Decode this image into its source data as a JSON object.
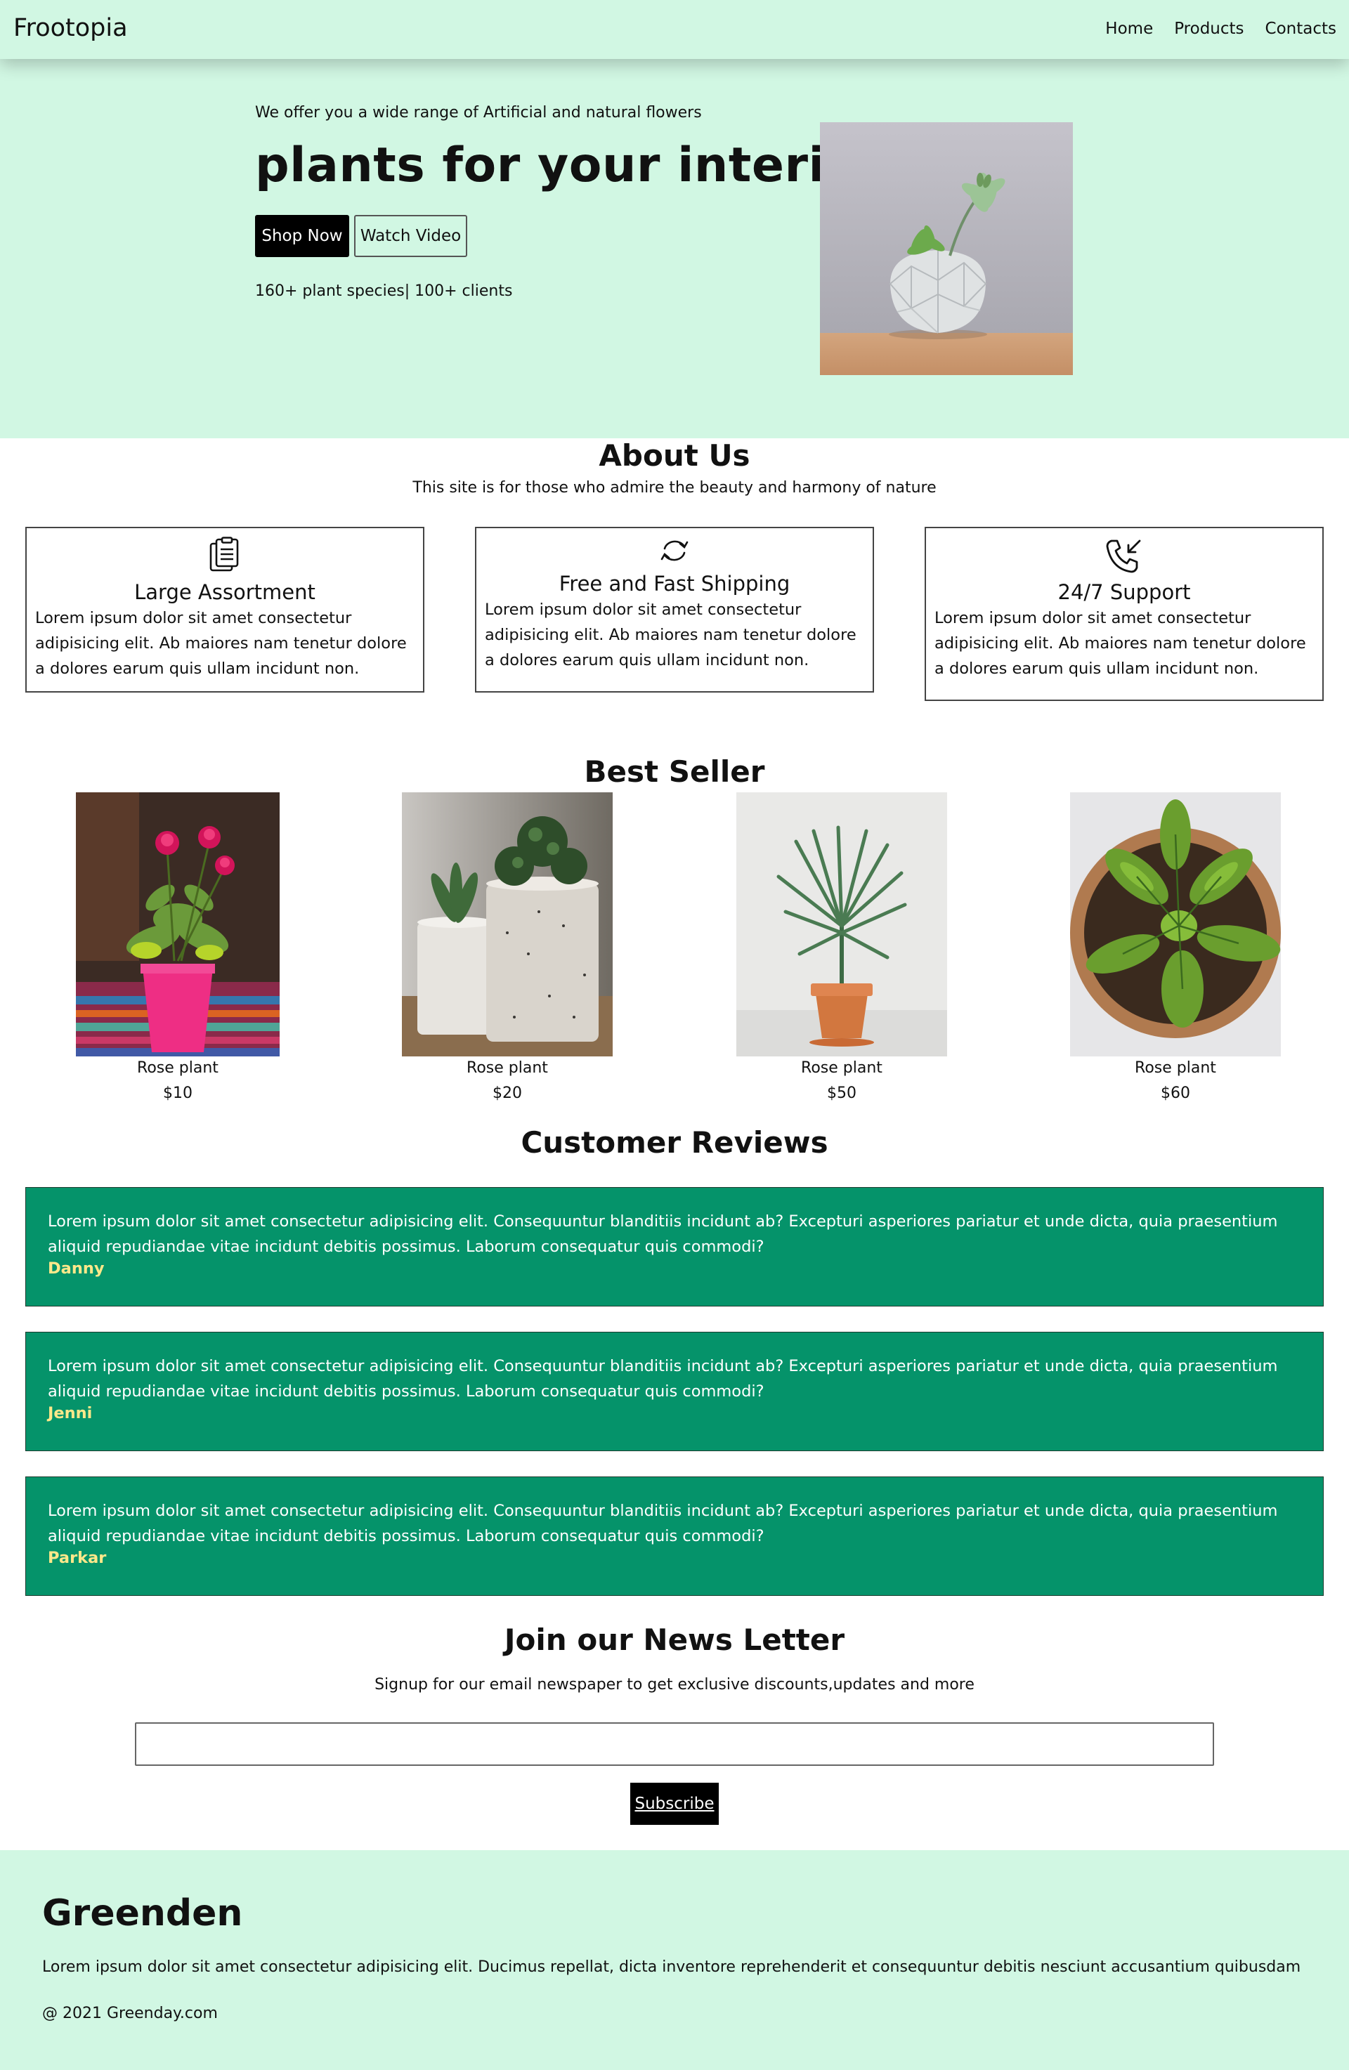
{
  "nav": {
    "brand": "Frootopia",
    "links": [
      "Home",
      "Products",
      "Contacts"
    ]
  },
  "hero": {
    "subtitle": "We offer you a wide range of Artificial and natural flowers",
    "title": "plants for your interior",
    "shop_label": "Shop Now",
    "watch_label": "Watch Video",
    "stats": "160+ plant species| 100+ clients"
  },
  "about": {
    "title": "About Us",
    "subtitle": "This site is for those who admire the beauty and harmony of nature",
    "cards": [
      {
        "icon": "clipboard-icon",
        "title": "Large Assortment",
        "text": "Lorem ipsum dolor sit amet consectetur adipisicing elit. Ab maiores nam tenetur dolore a dolores earum quis ullam incidunt non."
      },
      {
        "icon": "refresh-icon",
        "title": "Free and Fast Shipping",
        "text": "Lorem ipsum dolor sit amet consectetur adipisicing elit. Ab maiores nam tenetur dolore a dolores earum quis ullam incidunt non."
      },
      {
        "icon": "phone-incoming-icon",
        "title": "24/7 Support",
        "text": "Lorem ipsum dolor sit amet consectetur adipisicing elit. Ab maiores nam tenetur dolore a dolores earum quis ullam incidunt non."
      }
    ]
  },
  "best_seller": {
    "title": "Best Seller",
    "products": [
      {
        "name": "Rose plant",
        "price": "$10"
      },
      {
        "name": "Rose plant",
        "price": "$20"
      },
      {
        "name": "Rose plant",
        "price": "$50"
      },
      {
        "name": "Rose plant",
        "price": "$60"
      }
    ]
  },
  "reviews": {
    "title": "Customer Reviews",
    "items": [
      {
        "text": "Lorem ipsum dolor sit amet consectetur adipisicing elit. Consequuntur blanditiis incidunt ab? Excepturi asperiores pariatur et unde dicta, quia praesentium aliquid repudiandae vitae incidunt debitis possimus. Laborum consequatur quis commodi?",
        "name": "Danny"
      },
      {
        "text": "Lorem ipsum dolor sit amet consectetur adipisicing elit. Consequuntur blanditiis incidunt ab? Excepturi asperiores pariatur et unde dicta, quia praesentium aliquid repudiandae vitae incidunt debitis possimus. Laborum consequatur quis commodi?",
        "name": "Jenni"
      },
      {
        "text": "Lorem ipsum dolor sit amet consectetur adipisicing elit. Consequuntur blanditiis incidunt ab? Excepturi asperiores pariatur et unde dicta, quia praesentium aliquid repudiandae vitae incidunt debitis possimus. Laborum consequatur quis commodi?",
        "name": "Parkar"
      }
    ]
  },
  "newsletter": {
    "title": "Join our News Letter",
    "subtitle": "Signup for our email newspaper to get exclusive discounts,updates and more",
    "email_value": "",
    "subscribe_label": "Subscribe"
  },
  "footer": {
    "title": "Greenden",
    "text": "Lorem ipsum dolor sit amet consectetur adipisicing elit. Ducimus repellat, dicta inventore reprehenderit et consequuntur debitis nesciunt accusantium quibusdam",
    "copyright": "@ 2021 Greenday.com"
  },
  "colors": {
    "mint_bg": "#d1f7e3",
    "review_bg": "#05936a",
    "review_name": "#ffe88a"
  }
}
